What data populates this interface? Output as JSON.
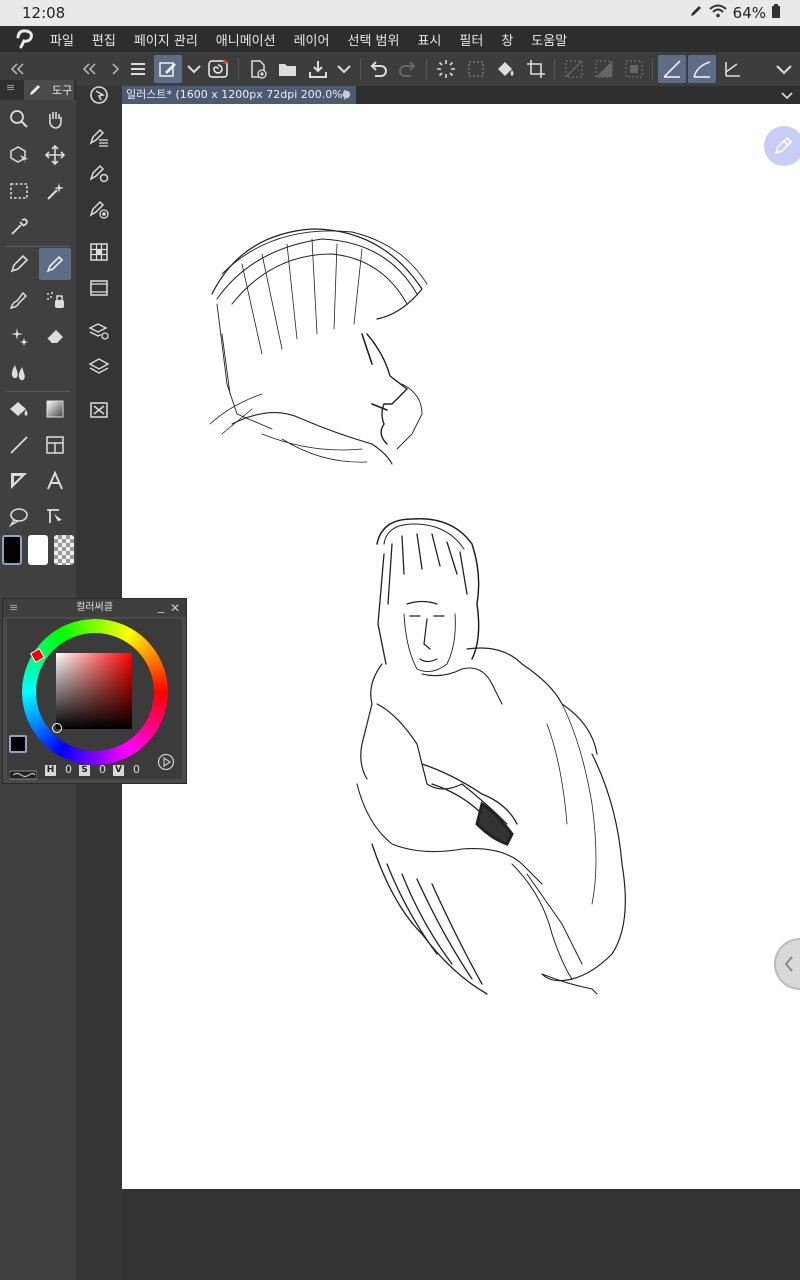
{
  "status": {
    "time": "12:08",
    "battery": "64%"
  },
  "menu": [
    "파일",
    "편집",
    "페이지 관리",
    "애니메이션",
    "레이어",
    "선택 범위",
    "표시",
    "필터",
    "창",
    "도움말"
  ],
  "tool_panel": {
    "tab_label": "도구"
  },
  "document": {
    "tab_title": "일러스트* (1600 x 1200px 72dpi 200.0%)"
  },
  "color_panel": {
    "title": "컬러써클",
    "h_label": "H",
    "h_value": "0",
    "s_label": "S",
    "s_value": "0",
    "v_label": "V",
    "v_value": "0"
  },
  "colors": {
    "accent": "#5f6c86",
    "tab": "#4d5a73",
    "floating_button": "#c8cdf5"
  }
}
